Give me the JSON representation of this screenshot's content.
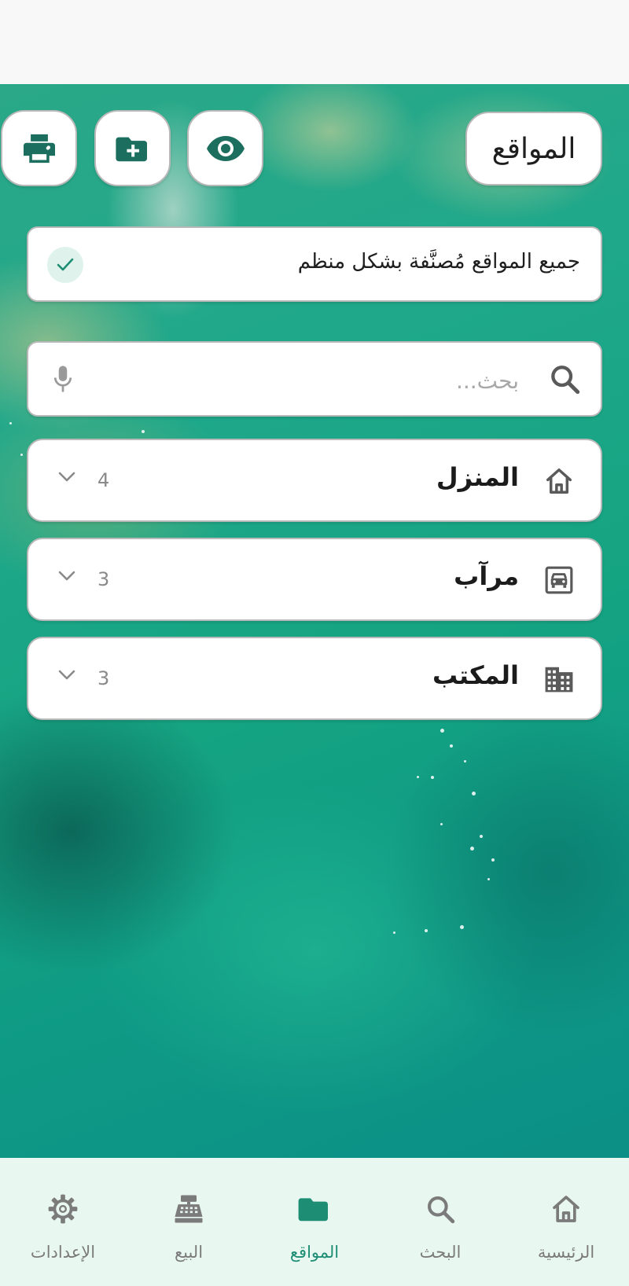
{
  "header": {
    "title": "المواقع",
    "actions": [
      {
        "name": "print",
        "icon": "print-icon"
      },
      {
        "name": "add-folder",
        "icon": "folder-plus-icon"
      },
      {
        "name": "view",
        "icon": "eye-icon"
      }
    ]
  },
  "status": {
    "text": "جميع المواقع مُصنَّفة بشكل منظم",
    "icon": "check-icon"
  },
  "search": {
    "placeholder": "بحث...",
    "value": "",
    "search_icon": "search-icon",
    "mic_icon": "microphone-icon"
  },
  "groups": [
    {
      "name": "المنزل",
      "count": "4",
      "icon": "home-icon"
    },
    {
      "name": "مرآب",
      "count": "3",
      "icon": "garage-icon"
    },
    {
      "name": "المكتب",
      "count": "3",
      "icon": "office-building-icon"
    }
  ],
  "nav": {
    "items": [
      {
        "label": "الرئيسية",
        "icon": "home-icon",
        "active": false
      },
      {
        "label": "البحث",
        "icon": "search-icon",
        "active": false
      },
      {
        "label": "المواقع",
        "icon": "folder-icon",
        "active": true
      },
      {
        "label": "البيع",
        "icon": "cash-register-icon",
        "active": false
      },
      {
        "label": "الإعدادات",
        "icon": "gear-icon",
        "active": false
      }
    ]
  },
  "colors": {
    "accent": "#1d8e74",
    "icon_dark": "#1c6f5e",
    "icon_gray": "#5a5a5a",
    "nav_bg": "#e9f7f1"
  }
}
